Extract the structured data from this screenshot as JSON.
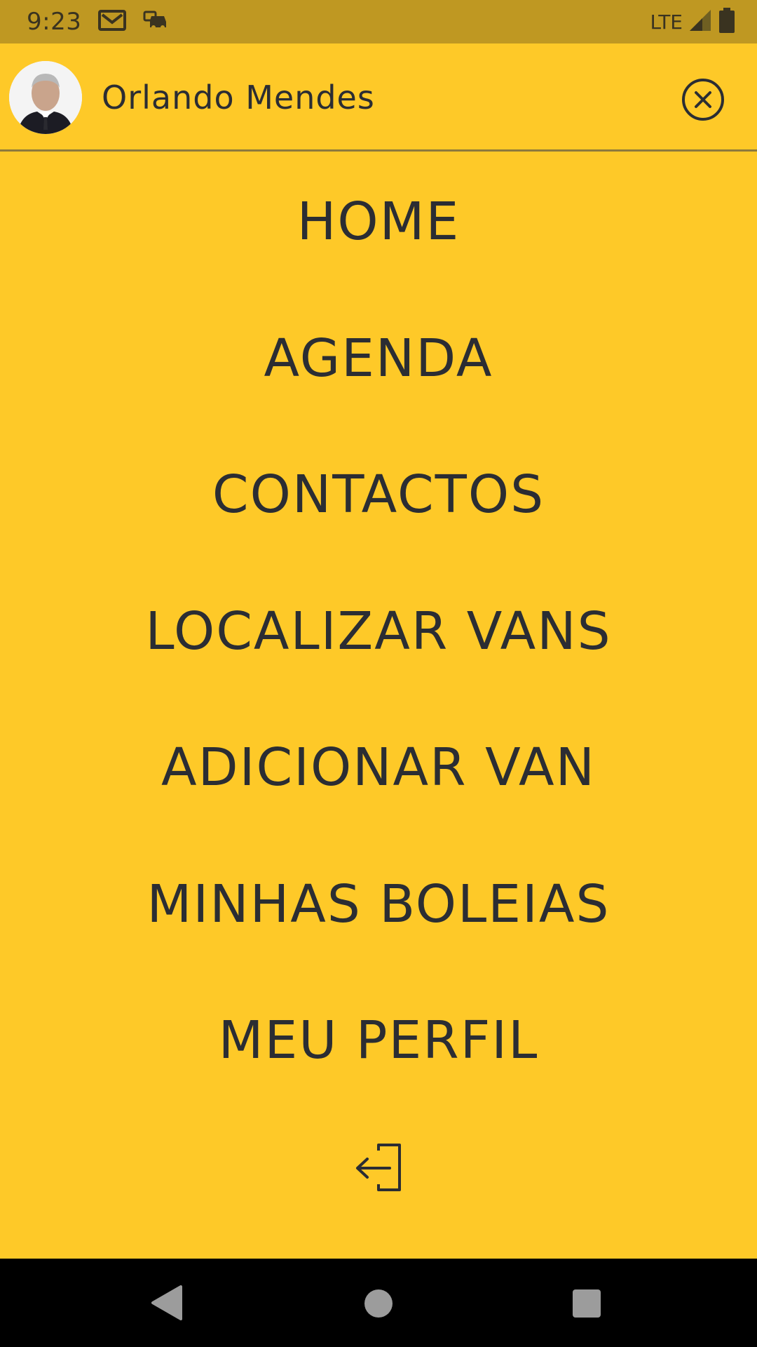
{
  "status_bar": {
    "time": "9:23",
    "network": "LTE",
    "icons": [
      "gmail-icon",
      "car-icon",
      "signal-icon",
      "battery-icon"
    ]
  },
  "header": {
    "user_name": "Orlando Mendes",
    "avatar": "avatar-photo",
    "close_icon": "close-circle-icon"
  },
  "menu": {
    "items": [
      {
        "label": "HOME"
      },
      {
        "label": "AGENDA"
      },
      {
        "label": "CONTACTOS"
      },
      {
        "label": "LOCALIZAR VANS"
      },
      {
        "label": "ADICIONAR VAN"
      },
      {
        "label": "MINHAS BOLEIAS"
      },
      {
        "label": "MEU PERFIL"
      }
    ],
    "logout_icon": "logout-icon"
  },
  "nav_bar": {
    "icons": [
      "back-icon",
      "home-icon",
      "recent-apps-icon"
    ]
  },
  "colors": {
    "background": "#fec928",
    "status_bar": "#bf9822",
    "text": "#2b2d33",
    "nav_bar": "#000000"
  }
}
